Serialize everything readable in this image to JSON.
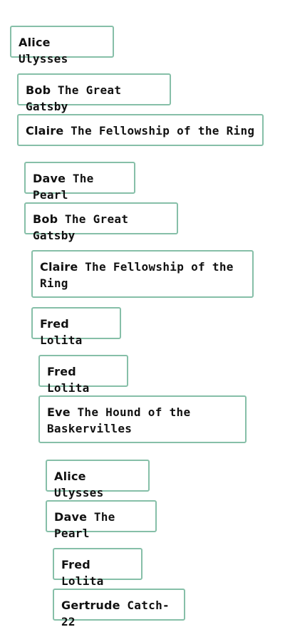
{
  "cards": [
    {
      "name": "Alice",
      "title": "Ulysses"
    },
    {
      "name": "Bob",
      "title": "The Great Gatsby"
    },
    {
      "name": "Claire",
      "title": "The Fellowship of the Ring"
    },
    {
      "name": "Dave",
      "title": "The Pearl"
    },
    {
      "name": "Bob",
      "title": "The Great Gatsby"
    },
    {
      "name": "Claire",
      "title": "The Fellowship of the Ring"
    },
    {
      "name": "Fred",
      "title": "Lolita"
    },
    {
      "name": "Fred",
      "title": "Lolita"
    },
    {
      "name": "Eve",
      "title": "The Hound of the Baskervilles"
    },
    {
      "name": "Alice",
      "title": "Ulysses"
    },
    {
      "name": "Dave",
      "title": "The Pearl"
    },
    {
      "name": "Fred",
      "title": "Lolita"
    },
    {
      "name": "Gertrude",
      "title": "Catch-22"
    }
  ],
  "colors": {
    "card_border": "#86bfa8",
    "text": "#111111",
    "background": "#ffffff"
  }
}
